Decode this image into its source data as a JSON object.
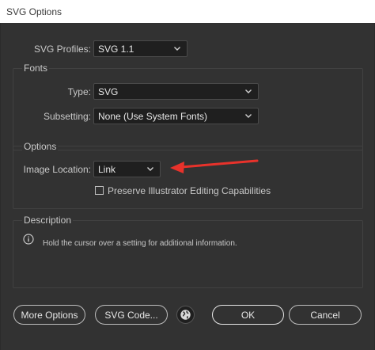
{
  "window": {
    "title": "SVG Options"
  },
  "svg_profiles": {
    "label": "SVG Profiles:",
    "value": "SVG 1.1"
  },
  "fonts": {
    "title": "Fonts",
    "type_label": "Type:",
    "type_value": "SVG",
    "subsetting_label": "Subsetting:",
    "subsetting_value": "None (Use System Fonts)"
  },
  "options": {
    "title": "Options",
    "image_location_label": "Image Location:",
    "image_location_value": "Link",
    "preserve_label": "Preserve Illustrator Editing Capabilities",
    "preserve_checked": false
  },
  "description": {
    "title": "Description",
    "text": "Hold the cursor over a setting for additional information."
  },
  "buttons": {
    "more_options": "More Options",
    "svg_code": "SVG Code...",
    "ok": "OK",
    "cancel": "Cancel"
  },
  "annotation": {
    "arrow_color": "#e8322b"
  }
}
